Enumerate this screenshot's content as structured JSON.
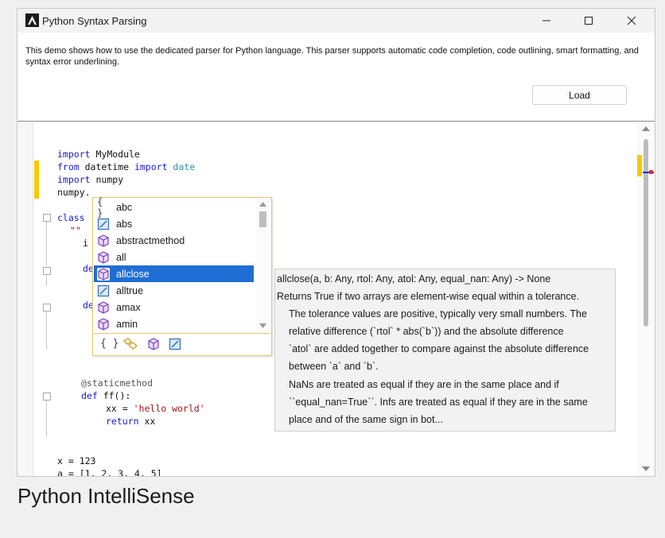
{
  "window": {
    "title": "Python Syntax Parsing",
    "minimize_glyph": "—",
    "maximize_glyph": "☐",
    "close_glyph": "✕"
  },
  "description": "This demo shows how to use the dedicated parser for Python language. This parser supports automatic code completion, code outlining, smart formatting, and syntax error underlining.",
  "load_button": "Load",
  "editor": {
    "lines": {
      "l1_kw": "import",
      "l1_rest": " MyModule",
      "l2_kw": "from",
      "l2_mod": " datetime ",
      "l2_kw2": "import",
      "l2_ty": " date",
      "l3_kw": "import",
      "l3_rest": " numpy",
      "l4": "numpy.",
      "l5_kw": "class",
      "l6": "\"\"",
      "l7": "i",
      "l8": "de",
      "l9": "de",
      "l10": "@staticmethod",
      "l11_kw": "def",
      "l11_rest": " ff():",
      "l12_a": "xx = ",
      "l12_str": "'hello world'",
      "l13_kw": "return",
      "l13_rest": " xx",
      "l14": "x = 123",
      "l15": "a = [1, 2, 3, 4, 5]"
    }
  },
  "completion": {
    "items": [
      {
        "icon": "braces-icon",
        "label": "abc"
      },
      {
        "icon": "method-icon",
        "label": "abs"
      },
      {
        "icon": "cube-icon",
        "label": "abstractmethod"
      },
      {
        "icon": "cube-icon",
        "label": "all"
      },
      {
        "icon": "cube-icon",
        "label": "allclose",
        "selected": true
      },
      {
        "icon": "method-icon",
        "label": "alltrue"
      },
      {
        "icon": "cube-icon",
        "label": "amax"
      },
      {
        "icon": "cube-icon",
        "label": "amin"
      }
    ],
    "filters": [
      "braces-icon",
      "keyword-icon",
      "cube-icon",
      "method-icon"
    ]
  },
  "tooltip": {
    "signature": "allclose(a, b: Any, rtol: Any, atol: Any, equal_nan: Any) -> None",
    "summary": "Returns True if two arrays are element-wise equal within a tolerance.",
    "body": [
      "The tolerance values are positive, typically very small numbers.  The",
      "relative difference (`rtol` * abs(`b`)) and the absolute difference",
      "`atol` are added together to compare against the absolute difference",
      "between `a` and `b`.",
      "NaNs are treated as equal if they are in the same place and if",
      "``equal_nan=True``. Infs are treated as equal if they are in the same",
      "place and of the same sign in bot..."
    ]
  },
  "caption": "Python IntelliSense",
  "colors": {
    "accent": "#1f6ed4",
    "change_marker": "#f5cb00",
    "keyword": "#1a1acf",
    "type": "#2b91af",
    "string": "#a31515"
  }
}
